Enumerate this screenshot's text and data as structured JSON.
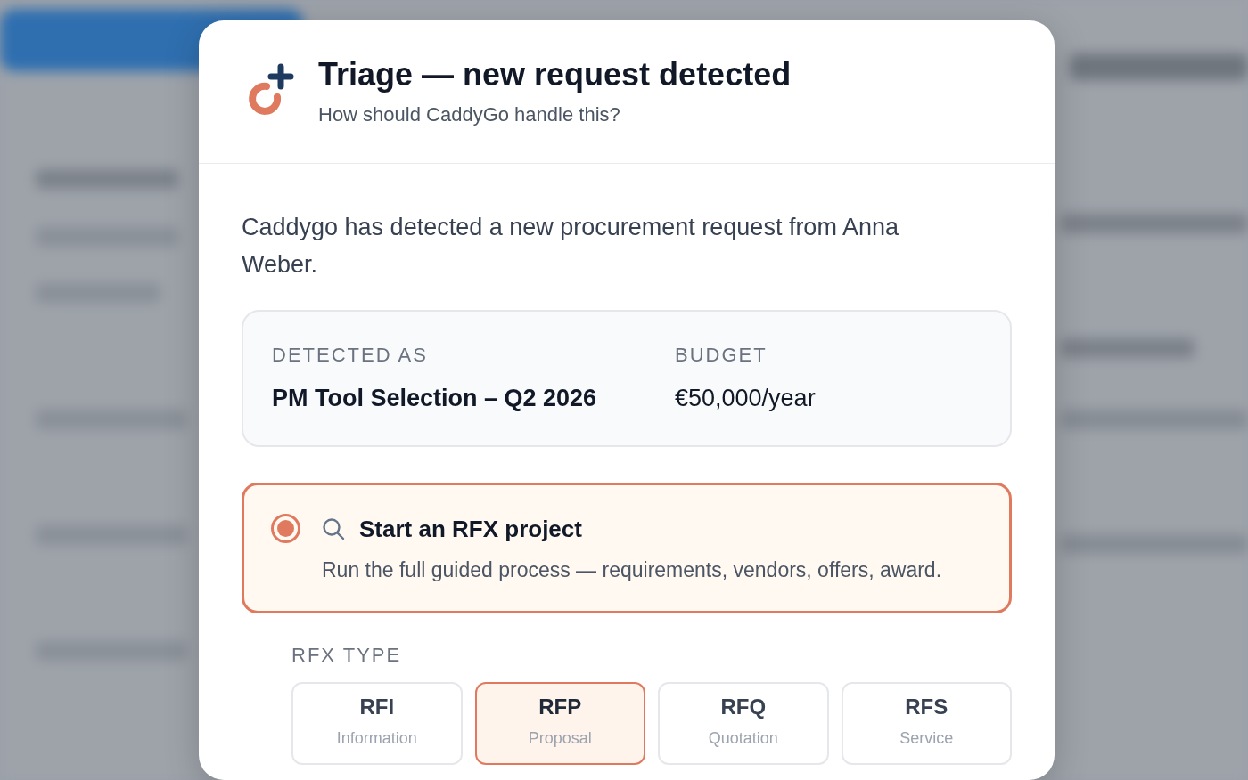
{
  "dialog": {
    "title": "Triage — new request detected",
    "subtitle": "How should CaddyGo handle this?"
  },
  "message": "Caddygo has detected a new procurement request from Anna Weber.",
  "detected": [
    {
      "label": "DETECTED AS",
      "value": "PM Tool Selection – Q2 2026",
      "bold": true
    },
    {
      "label": "BUDGET",
      "value": "€50,000/year",
      "bold": false
    }
  ],
  "options": [
    {
      "title": "Start an RFX project",
      "description": "Run the full guided process — requirements, vendors, offers, award.",
      "selected": true
    }
  ],
  "rfx_type": {
    "label": "RFX TYPE",
    "types": [
      {
        "code": "RFI",
        "name": "Information",
        "selected": false
      },
      {
        "code": "RFP",
        "name": "Proposal",
        "selected": true
      },
      {
        "code": "RFQ",
        "name": "Quotation",
        "selected": false
      },
      {
        "code": "RFS",
        "name": "Service",
        "selected": false
      }
    ]
  }
}
